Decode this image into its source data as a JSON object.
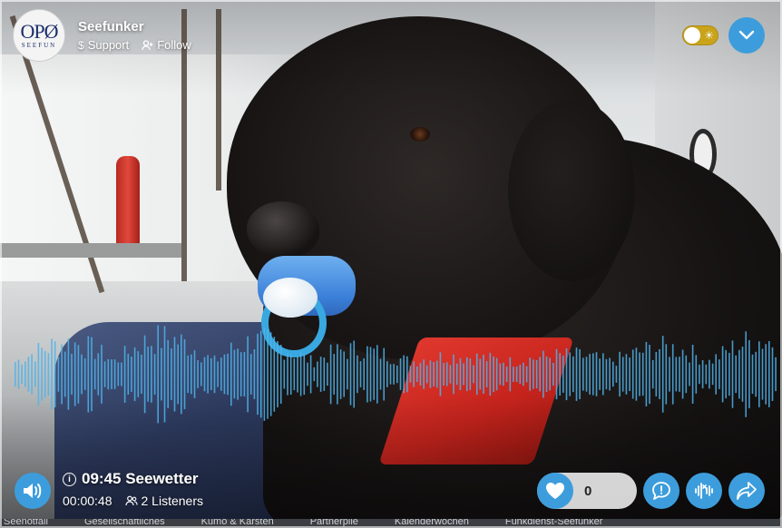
{
  "station": {
    "name": "Seefunker",
    "logo_text": "OPØ",
    "logo_subtext": "SEEFUN",
    "support_label": "Support",
    "follow_label": "Follow"
  },
  "controls": {
    "theme_icon": "sun-icon",
    "menu_icon": "chevron-down-icon",
    "play_icon": "speaker-icon"
  },
  "now_playing": {
    "title": "09:45 Seewetter",
    "elapsed": "00:00:48",
    "listeners": "2 Listeners"
  },
  "actions": {
    "like_count": "0",
    "chat_icon": "chat-icon",
    "mute_icon": "waveform-mute-icon",
    "share_icon": "share-icon"
  },
  "footer_links": [
    "Seenotfall",
    "Gesellschaftliches",
    "Kümo & Karsten",
    "Partnerpile",
    "Kalenderwochen",
    "Funkdienst-Seefunker"
  ],
  "colors": {
    "accent": "#3d9ddc",
    "toggle": "#c9a41a",
    "waveform": "#4fb3ea"
  }
}
